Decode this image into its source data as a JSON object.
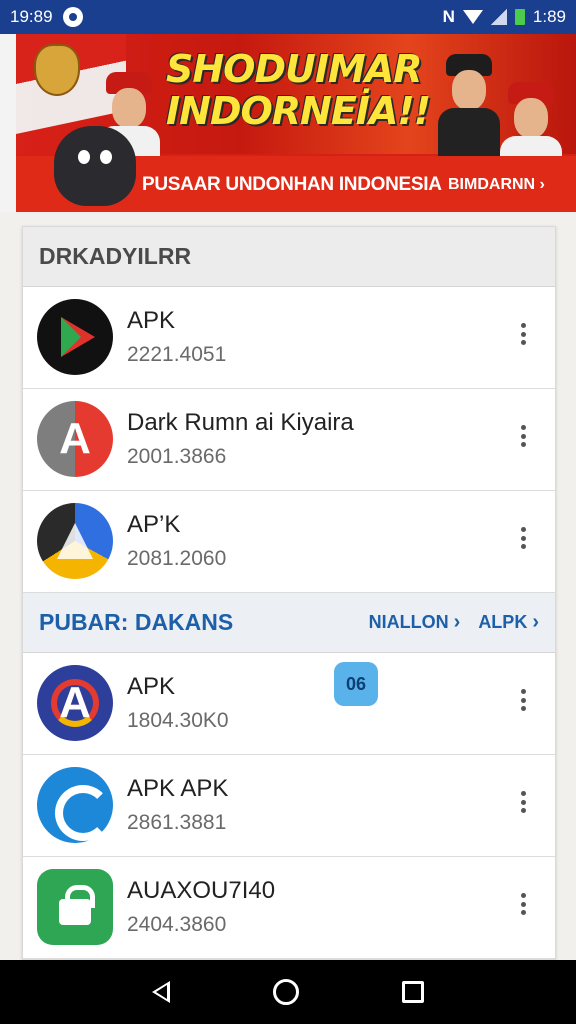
{
  "status_bar": {
    "time_left": "19:89",
    "network_letter": "N",
    "time_right": "1​:89",
    "icons": [
      "notification-icon",
      "nfc-icon",
      "wifi-icon",
      "signal-icon",
      "battery-icon"
    ]
  },
  "banner": {
    "headline_line1": "SHODUIMAR",
    "headline_line2": "INDORNEİA!!",
    "strip_text": "PUSAAR UNDONHAN INDONESIA",
    "strip_link": "BIMDARNN ›"
  },
  "sections": [
    {
      "title": "DRKADYILRR",
      "items": [
        {
          "name": "APK",
          "version": "2221.4051",
          "icon": "play-icon"
        },
        {
          "name": "Dark Rumn ai Kiyaira",
          "version": "2001.3866",
          "icon": "a-logo-icon"
        },
        {
          "name": "AP’K",
          "version": "2081.2060",
          "icon": "drive-icon"
        }
      ]
    },
    {
      "title": "PUBAR: DAKANS",
      "link1": "NIALLON",
      "link2": "ALPK",
      "items": [
        {
          "name": "APK",
          "version": "1804.30K0",
          "icon": "a-bolt-icon"
        },
        {
          "name": "APK APK",
          "version": "2861.3881",
          "icon": "ring-icon"
        },
        {
          "name": "AUAXOU7I40",
          "version": "2404.3860",
          "icon": "lock-icon"
        }
      ]
    }
  ],
  "badge": "06",
  "colors": {
    "status_bar": "#1b3f8f",
    "banner_red": "#d61f16",
    "headline_yellow": "#ffe53a",
    "section_blue": "#1d5fa8"
  }
}
